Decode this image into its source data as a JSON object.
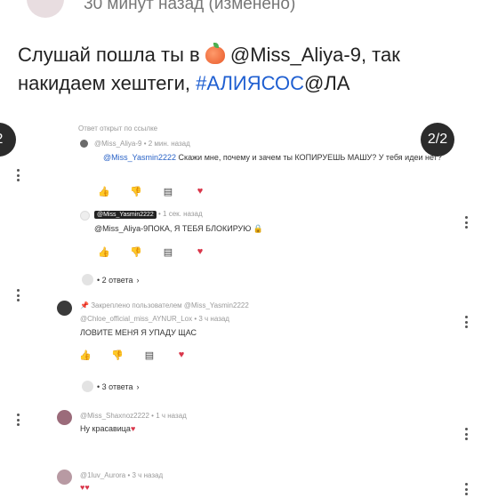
{
  "post": {
    "time": "30 минут назад (изменено)",
    "text_part1": "Слушай пошла ты в ",
    "text_part2": " @Miss_Aliya-9, так накидаем хештеги, ",
    "hashtag": "#АЛИЯСОС",
    "text_part3": "@ЛА"
  },
  "pager": {
    "left": "2",
    "right": "2/2"
  },
  "thread": {
    "header": "Ответ открыт по ссылке",
    "comment1": {
      "meta": "@Miss_Aliya-9 • 2 мин. назад",
      "mention": "@Miss_Yasmin2222",
      "text": " Скажи мне, почему и зачем ты КОПИРУЕШЬ МАШУ? У тебя идеи нет?"
    },
    "comment2": {
      "author": "@Miss_Yasmin2222",
      "meta": " • 1 сек. назад",
      "text": "@Miss_Aliya-9ПОКА, Я ТЕБЯ БЛОКИРУЮ 🔒"
    },
    "replies1": "• 2 ответа",
    "comment3": {
      "pinned": "Закреплено пользователем @Miss_Yasmin2222",
      "meta": "@Chloe_official_miss_AYNUR_Lox • 3 ч назад",
      "text": "ЛОВИТЕ МЕНЯ Я УПАДУ ЩАС"
    },
    "replies2": "• 3 ответа",
    "comment4": {
      "meta": "@Miss_Shaxnoz2222 • 1 ч назад",
      "text": "Ну красавица"
    },
    "comment5": {
      "meta": "@1luv_Aurora • 3 ч назад",
      "text": "♥♥"
    }
  },
  "colors": {
    "link": "#1f5fd1",
    "pager_bg": "#2b2b2b",
    "heart": "#d9364a"
  }
}
